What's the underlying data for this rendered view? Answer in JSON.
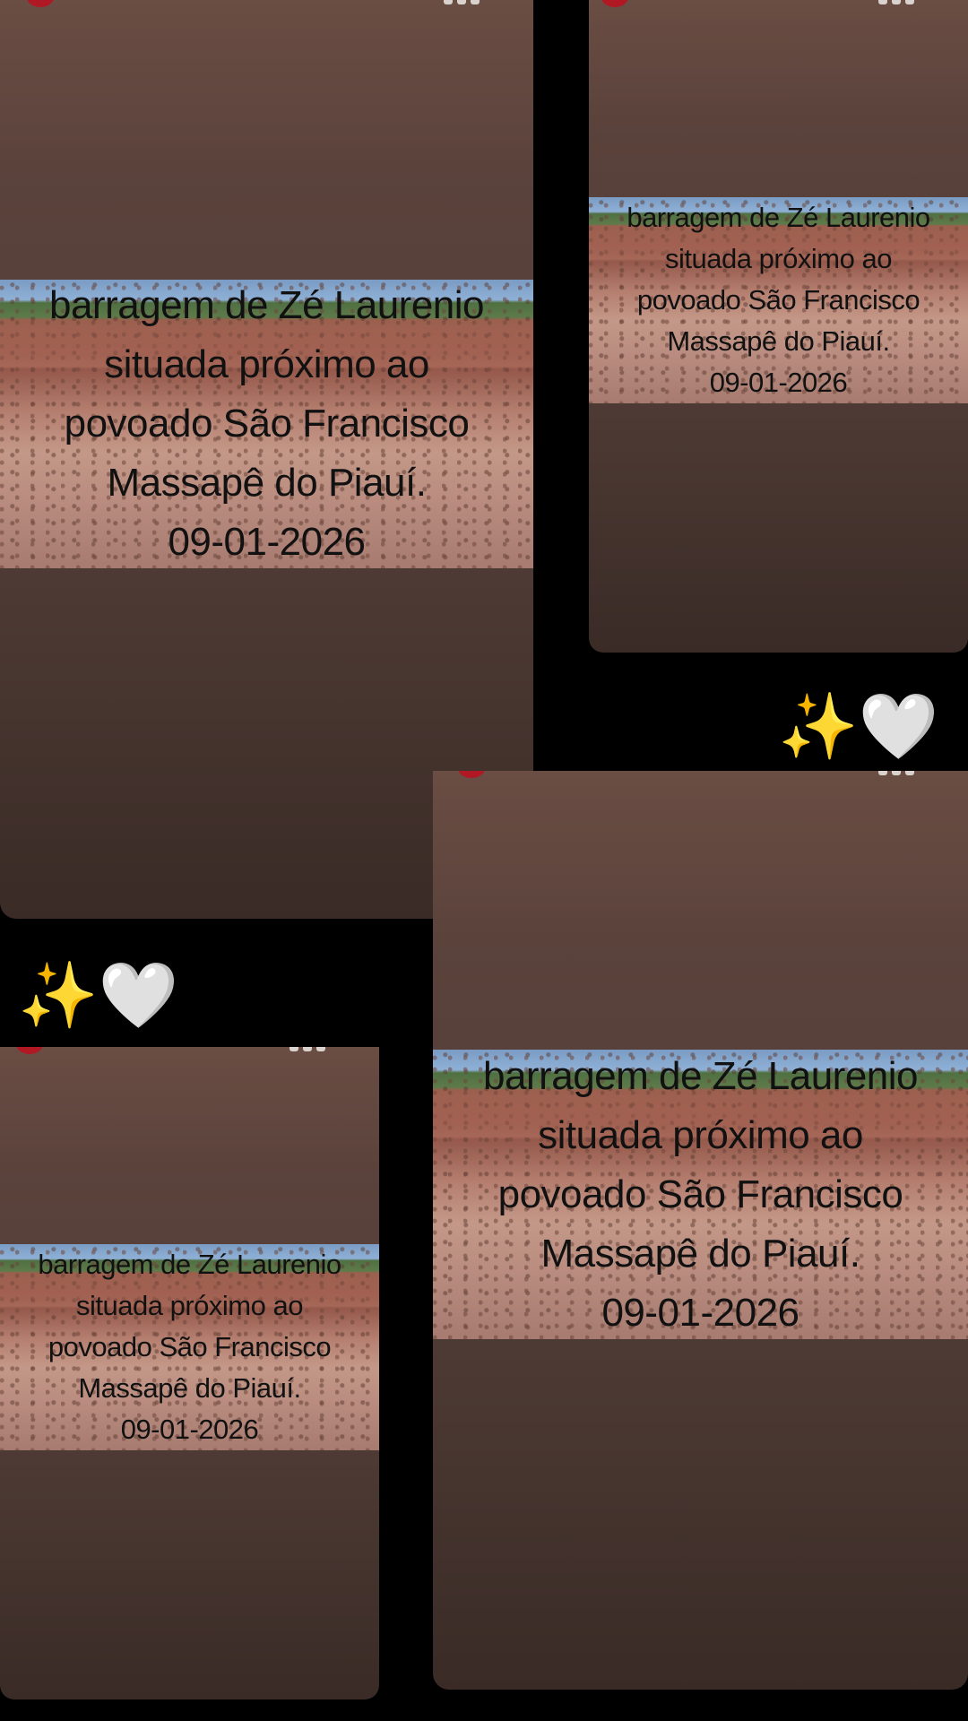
{
  "stories": [
    {
      "caption": {
        "line1": "barragem de Zé Laurenio",
        "line2": "situada próximo ao",
        "line3": "povoado São Francisco",
        "line4": "Massapê do Piauí.",
        "line5": "09-01-2026"
      }
    },
    {
      "caption": {
        "line1": "barragem de Zé Laurenio",
        "line2": "situada próximo ao",
        "line3": "povoado São Francisco",
        "line4": "Massapê do Piauí.",
        "line5": "09-01-2026"
      }
    },
    {
      "caption": {
        "line1": "barragem de Zé Laurenio",
        "line2": "situada próximo ao",
        "line3": "povoado São Francisco",
        "line4": "Massapê do Piauí.",
        "line5": "09-01-2026"
      }
    },
    {
      "caption": {
        "line1": "barragem de Zé Laurenio",
        "line2": "situada próximo ao",
        "line3": "povoado São Francisco",
        "line4": "Massapê do Piauí.",
        "line5": "09-01-2026"
      }
    }
  ],
  "reactions": [
    {
      "sparkles": "✨",
      "heart": "🤍"
    },
    {
      "sparkles": "✨",
      "heart": "🤍"
    }
  ],
  "colors": {
    "background": "#000000",
    "card_top": "#6a4d43",
    "card_bottom": "#3a2b26",
    "caption_text": "#111111"
  },
  "icons": [
    "profile-avatar-icon",
    "status-icon"
  ]
}
